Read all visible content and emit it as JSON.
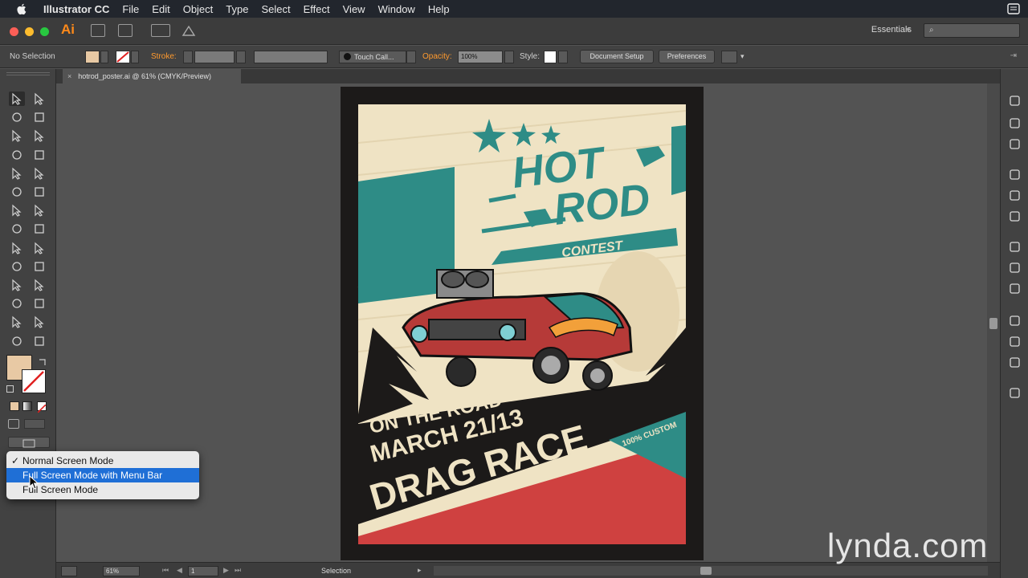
{
  "menubar": {
    "app_name": "Illustrator CC",
    "items": [
      "File",
      "Edit",
      "Object",
      "Type",
      "Select",
      "Effect",
      "View",
      "Window",
      "Help"
    ]
  },
  "appbar": {
    "logo": "Ai",
    "workspace": "Essentials",
    "search_placeholder": "⌕"
  },
  "control": {
    "selection_label": "No Selection",
    "stroke_label": "Stroke:",
    "brush_label": "Touch Call...",
    "opacity_label": "Opacity:",
    "opacity_value": "100%",
    "style_label": "Style:",
    "document_setup": "Document Setup",
    "preferences": "Preferences"
  },
  "doc_tab": {
    "close": "×",
    "title": "hotrod_poster.ai @ 61% (CMYK/Preview)"
  },
  "screen_mode_menu": {
    "checkmark": "✓",
    "items": [
      "Normal Screen Mode",
      "Full Screen Mode with Menu Bar",
      "Full Screen Mode"
    ],
    "checked_index": 0,
    "highlighted_index": 1
  },
  "poster": {
    "title_line1": "HOT",
    "title_line2": "ROD",
    "subtitle": "CONTEST",
    "line1": "ON THE ROAD",
    "line2": "MARCH 21/13",
    "line3": "DRAG RACE",
    "badge": "100% CUSTOM",
    "colors": {
      "cream": "#efe3c4",
      "teal": "#2e8c86",
      "red": "#cf4140",
      "dark": "#1c1a19"
    }
  },
  "statusbar": {
    "zoom": "61%",
    "artboard": "1",
    "status": "Selection"
  },
  "watermark": "lynda.com"
}
